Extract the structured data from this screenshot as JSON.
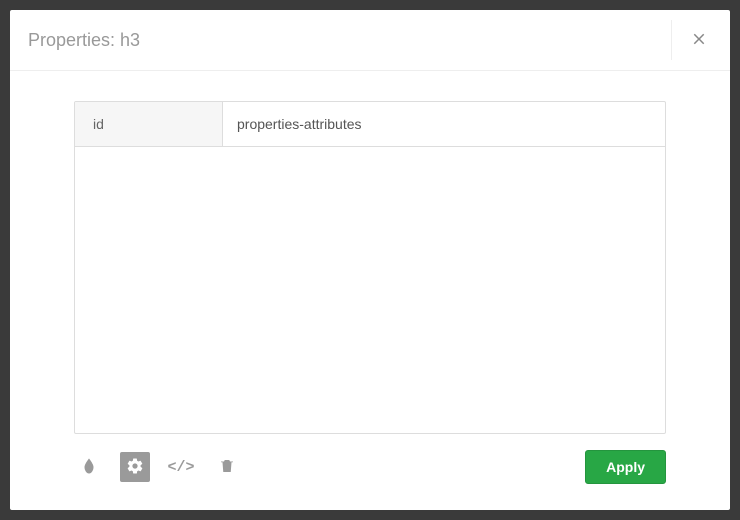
{
  "header": {
    "title": "Properties: h3"
  },
  "attributes": [
    {
      "key": "id",
      "value": "properties-attributes"
    }
  ],
  "footer": {
    "apply_label": "Apply"
  },
  "icons": {
    "drop": "drop-icon",
    "gear": "gear-icon",
    "code": "code-icon",
    "trash": "trash-icon",
    "close": "close-icon"
  },
  "colors": {
    "accent": "#28a745",
    "muted": "#9a9a9a",
    "panel_bg": "#ffffff",
    "backdrop": "#3a3a3a"
  }
}
